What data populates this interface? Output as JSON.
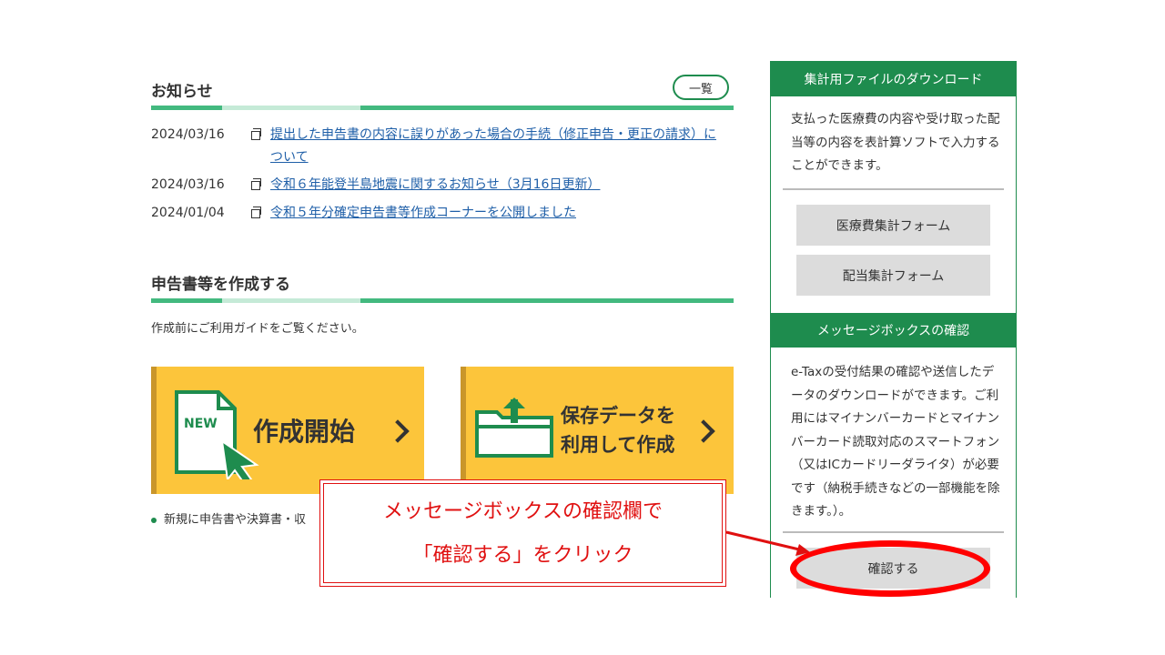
{
  "news": {
    "title": "お知らせ",
    "list_button": "一覧",
    "items": [
      {
        "date": "2024/03/16",
        "text": "提出した申告書の内容に誤りがあった場合の手続（修正申告・更正の請求）に",
        "text2": "ついて"
      },
      {
        "date": "2024/03/16",
        "text": "令和６年能登半島地震に関するお知らせ（3月16日更新）"
      },
      {
        "date": "2024/01/04",
        "text": "令和５年分確定申告書等作成コーナーを公開しました"
      }
    ]
  },
  "create": {
    "title": "申告書等を作成する",
    "guide": "作成前にご利用ガイドをご覧ください。",
    "start_button": {
      "badge": "NEW",
      "label": "作成開始"
    },
    "saved_button": {
      "line1": "保存データを",
      "line2": "利用して作成"
    },
    "bullet": "新規に申告書や決算書・収"
  },
  "sidebar": {
    "download_title": "集計用ファイルのダウンロード",
    "download_text": "支払った医療費の内容や受け取った配当等の内容を表計算ソフトで入力することができます。",
    "medical_button": "医療費集計フォーム",
    "dividend_button": "配当集計フォーム",
    "message_title": "メッセージボックスの確認",
    "message_text": "e-Taxの受付結果の確認や送信したデータのダウンロードができます。ご利用にはマイナンバーカードとマイナンバーカード読取対応のスマートフォン（又はICカードリーダライタ）が必要です（納税手続きなどの一部機能を除きます。）。",
    "confirm_button": "確認する"
  },
  "callout": {
    "line1": "メッセージボックスの確認欄で",
    "line2": "「確認する」をクリック"
  },
  "colors": {
    "brand_green": "#1e8c4e",
    "accent_yellow": "#fcc53b",
    "link_blue": "#1f5fa8",
    "callout_red": "#e01010"
  }
}
